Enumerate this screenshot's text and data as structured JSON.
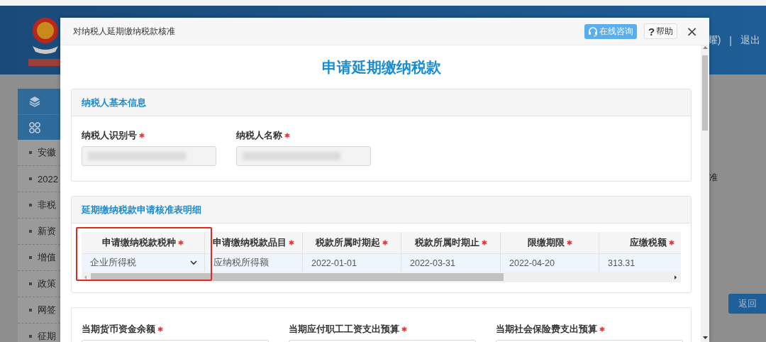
{
  "background_page": {
    "header": {
      "user_fragment": "耀)",
      "separator": "|",
      "logout": "退出"
    },
    "sidebar": {
      "menus": [
        {
          "kind": "layers"
        },
        {
          "kind": "grid"
        }
      ],
      "items": [
        "安徽",
        "2022",
        "非税",
        "新资",
        "增值",
        "政策",
        "网签",
        "征期"
      ]
    },
    "content_fragment": "准",
    "return_button": "返回"
  },
  "dialog": {
    "title": "对纳税人延期缴纳税款核准",
    "buttons": [
      {
        "kind": "consult",
        "label": "在线咨询"
      },
      {
        "kind": "help",
        "icon_text": "?",
        "label": "帮助"
      }
    ],
    "close": "×",
    "heading": "申请延期缴纳税款",
    "sections": [
      {
        "kind": "fields",
        "title": "纳税人基本信息",
        "fields": [
          {
            "label": "纳税人识别号",
            "required": true,
            "redacted": true
          },
          {
            "label": "纳税人名称",
            "required": true,
            "redacted": true
          }
        ]
      },
      {
        "kind": "table",
        "title": "延期缴纳税款申请核准表明细",
        "columns": [
          {
            "label": "申请缴纳税款税种",
            "required": true,
            "highlighted": true
          },
          {
            "label": "申请缴纳税款品目",
            "required": true,
            "highlighted": false
          },
          {
            "label": "税款所属时期起",
            "required": true,
            "highlighted": false
          },
          {
            "label": "税款所属时期止",
            "required": true,
            "highlighted": false
          },
          {
            "label": "限缴期限",
            "required": true,
            "highlighted": false
          },
          {
            "label": "应缴税额",
            "required": true,
            "highlighted": false
          }
        ],
        "rows": [
          [
            {
              "kind": "select",
              "value": "企业所得税"
            },
            {
              "kind": "text",
              "value": "应纳税所得额"
            },
            {
              "kind": "text",
              "value": "2022-01-01"
            },
            {
              "kind": "text",
              "value": "2022-03-31"
            },
            {
              "kind": "text",
              "value": "2022-04-20"
            },
            {
              "kind": "text",
              "value": "313.31"
            }
          ]
        ]
      },
      {
        "kind": "fields",
        "fields": [
          {
            "label": "当期货币资金余额",
            "required": true
          },
          {
            "label": "当期应付职工工资支出预算",
            "required": true
          },
          {
            "label": "当期社会保险费支出预算",
            "required": true
          }
        ]
      }
    ]
  }
}
